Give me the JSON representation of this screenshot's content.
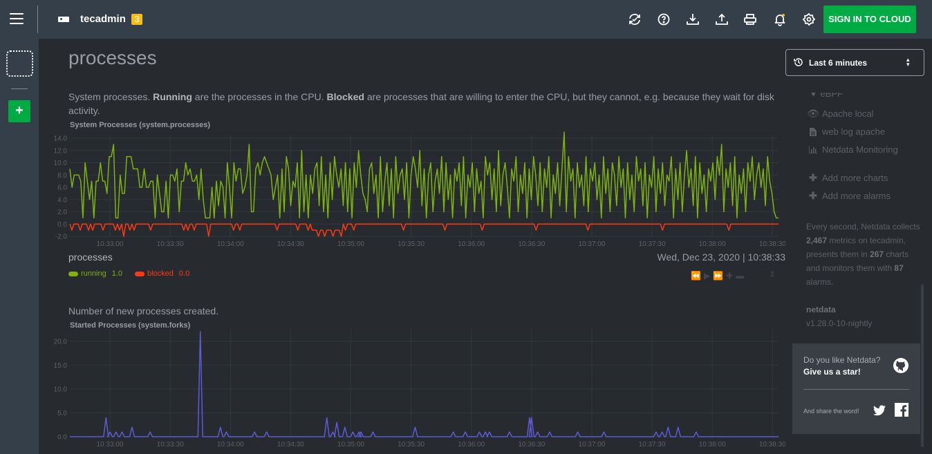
{
  "header": {
    "menu_icon": "hamburger-menu-icon",
    "host_icon": "server-icon",
    "hostname": "tecadmin",
    "alarm_badge": "3",
    "icons": [
      "sync-icon",
      "help-icon",
      "download-icon",
      "upload-icon",
      "print-icon",
      "bell-icon",
      "gear-icon"
    ],
    "signin_label": "SIGN IN TO CLOUD",
    "accent": "#00ab44",
    "badge_color": "#f7be17"
  },
  "leftbar": {
    "add_label": "+"
  },
  "section": {
    "title": "processes",
    "description_parts": [
      "System processes. ",
      "Running",
      " are the processes in the CPU. ",
      "Blocked",
      " are processes that are willing to enter the CPU, but they cannot, e.g. because they wait for disk activity."
    ],
    "forks_description": "Number of new processes created."
  },
  "legend": {
    "name": "processes",
    "datetime": "Wed, Dec 23, 2020 | 10:38:33",
    "items": [
      {
        "label": "running",
        "value": "1.0",
        "color": "#7eb30f"
      },
      {
        "label": "blocked",
        "value": "0.0",
        "color": "#fe3912"
      }
    ]
  },
  "timepicker": {
    "label": "Last 6 minutes"
  },
  "rightnav": {
    "items": [
      {
        "label": "Apache local",
        "icon": "eye-icon"
      },
      {
        "label": "web log apache",
        "icon": "file-icon"
      },
      {
        "label": "Netdata Monitoring",
        "icon": "bar-chart-icon"
      },
      {
        "label": "Add more charts",
        "icon": "plus-icon"
      },
      {
        "label": "Add more alarms",
        "icon": "plus-icon"
      }
    ],
    "stats": {
      "prefix": "Every second, Netdata collects ",
      "metrics": "2,467",
      "mid1": " metrics on tecadmin, presents them in ",
      "charts": "267",
      "mid2": " charts and monitors them with ",
      "alarms": "87",
      "suffix": " alarms."
    },
    "product": "netdata",
    "version": "v1.28.0-10-nightly",
    "star_question": "Do you like Netdata?",
    "star_cta": "Give us a star!",
    "share_text": "And share the word!"
  },
  "chart_data": [
    {
      "type": "line",
      "title": "System Processes (system.processes)",
      "ylim": [
        -2,
        14
      ],
      "yticks": [
        "14.0",
        "12.0",
        "10.0",
        "8.0",
        "6.0",
        "4.0",
        "2.0",
        "0.0",
        "-2.0"
      ],
      "ytick_values": [
        14,
        12,
        10,
        8,
        6,
        4,
        2,
        0,
        -2
      ],
      "xticks": [
        "10:33:00",
        "10:33:30",
        "10:34:00",
        "10:34:30",
        "10:35:00",
        "10:35:30",
        "10:36:00",
        "10:36:30",
        "10:37:00",
        "10:37:30",
        "10:38:00",
        "10:38:30"
      ],
      "x_range_seconds": [
        -20,
        333
      ],
      "grid": true,
      "series": [
        {
          "name": "running",
          "color": "#7eb30f",
          "values": [
            9,
            6,
            8,
            8,
            8,
            7,
            1,
            10,
            7,
            4,
            7,
            1,
            7,
            7,
            10,
            7,
            7,
            5,
            11,
            11,
            13,
            1,
            1,
            8,
            5,
            5,
            11,
            11,
            11,
            9,
            9,
            9,
            6,
            6,
            9,
            6,
            6,
            7,
            7,
            1,
            8,
            5,
            2,
            2,
            7,
            1,
            8,
            8,
            7,
            9,
            2,
            7,
            7,
            10,
            8,
            9,
            7,
            7,
            8,
            4,
            9,
            4,
            1,
            1,
            1,
            6,
            1,
            7,
            3,
            7,
            6,
            1,
            10,
            6,
            1,
            10,
            7,
            9,
            9,
            5,
            6,
            8,
            13,
            2,
            2,
            9,
            10,
            8,
            10,
            11,
            10,
            9,
            8,
            4,
            6,
            8,
            1,
            9,
            2,
            11,
            9,
            3,
            7,
            6,
            10,
            1,
            12,
            2,
            8,
            1,
            8,
            5,
            9,
            10,
            3,
            11,
            2,
            8,
            1,
            10,
            4,
            11,
            8,
            6,
            9,
            3,
            10,
            2,
            9,
            1,
            10,
            6,
            12,
            8,
            5,
            4,
            2,
            9,
            10,
            5,
            8,
            1,
            11,
            2,
            7,
            10,
            3,
            9,
            1,
            11,
            5,
            8,
            9,
            4,
            10,
            1,
            8,
            11,
            9,
            6,
            12,
            3,
            9,
            1,
            8,
            10,
            2,
            7,
            9,
            5,
            11,
            2,
            10,
            4,
            8,
            1,
            9,
            7,
            10,
            3,
            11,
            1,
            8,
            6,
            10,
            2,
            9,
            5,
            7,
            1,
            11,
            8,
            10,
            4,
            9,
            2,
            12,
            3,
            8,
            10,
            6,
            1,
            9,
            7,
            11,
            2,
            8,
            5,
            10,
            1,
            9,
            4,
            11,
            8,
            3,
            10,
            2,
            9,
            6,
            11,
            1,
            8,
            5,
            10,
            3,
            9,
            15,
            2,
            11,
            7,
            9,
            1,
            10,
            6,
            8,
            3,
            11,
            2,
            9,
            7,
            10,
            4,
            8,
            1,
            11,
            5,
            9,
            2,
            10,
            8,
            3,
            11,
            6,
            9,
            1,
            10,
            4,
            8,
            2,
            11,
            7,
            9,
            3,
            10,
            1,
            8,
            6,
            11,
            2,
            9,
            5,
            10,
            3,
            8,
            7,
            11,
            1,
            9,
            4,
            10,
            2,
            8,
            12,
            6,
            9,
            3,
            11,
            1,
            10,
            5,
            8,
            2,
            9,
            7,
            10,
            4,
            11,
            8,
            13,
            2,
            9,
            6,
            10,
            3,
            11,
            1,
            8,
            5,
            9,
            2,
            10,
            7,
            11,
            4,
            8,
            10,
            6,
            9,
            3,
            11,
            7,
            5,
            2,
            1,
            1
          ]
        },
        {
          "name": "blocked",
          "color": "#fe3912",
          "values": [
            0,
            -1,
            0,
            0,
            0,
            -1,
            0,
            0,
            0,
            -1,
            0,
            -1,
            0,
            0,
            0,
            0,
            -1,
            0,
            0,
            0,
            0,
            0,
            -1,
            0,
            -1,
            0,
            -2,
            0,
            0,
            -1,
            0,
            -1,
            0,
            0,
            0,
            0,
            0,
            0,
            0,
            -1,
            0,
            0,
            0,
            0,
            0,
            0,
            0,
            0,
            0,
            0,
            0,
            0,
            0,
            0,
            0,
            -1,
            0,
            -1,
            0,
            0,
            -1,
            0,
            0,
            0,
            0,
            0,
            0,
            -2,
            0,
            0,
            0,
            0,
            0,
            0,
            0,
            0,
            0,
            0,
            0,
            -1,
            0,
            0,
            -1,
            0,
            0,
            0,
            0,
            0,
            0,
            0,
            0,
            0,
            0,
            0,
            0,
            0,
            0,
            0,
            0,
            0,
            -1,
            0,
            0,
            0,
            0,
            0,
            0,
            0,
            0,
            0,
            -1,
            0,
            0,
            0,
            0,
            -1,
            0,
            -1,
            -1,
            -1,
            -2,
            -1,
            -1,
            -2,
            -1,
            -1,
            -1,
            -2,
            -1,
            -1,
            -1,
            -2,
            0,
            -1,
            0,
            0,
            0,
            -1,
            0,
            0,
            0,
            0,
            0,
            0,
            0,
            0,
            0,
            0,
            0,
            0,
            0,
            0,
            0,
            0,
            0,
            0,
            0,
            0,
            0,
            0,
            0,
            -1,
            0,
            0,
            0,
            0,
            0,
            0,
            0,
            0,
            0,
            0,
            0,
            0,
            0,
            0,
            0,
            0,
            0,
            0,
            0,
            -1,
            0,
            0,
            0,
            0,
            0,
            0,
            0,
            0,
            0,
            0,
            0,
            0,
            0,
            0,
            0,
            0,
            0,
            -1,
            0,
            0,
            0,
            0,
            0,
            0,
            0,
            0,
            0,
            0,
            0,
            0,
            0,
            0,
            0,
            0,
            0,
            0,
            0,
            0,
            0,
            0,
            0,
            0,
            0,
            -1,
            0,
            0,
            0,
            0,
            0,
            0,
            0,
            0,
            0,
            0,
            0,
            0,
            0,
            0,
            0,
            0,
            0,
            0,
            0,
            0,
            0,
            0,
            0,
            0,
            -1,
            0,
            0,
            0,
            0,
            0,
            0,
            0,
            0,
            0,
            0,
            0,
            0,
            0,
            0,
            0,
            0,
            0,
            0,
            0,
            0,
            0,
            0,
            0,
            0,
            0,
            0,
            0,
            0,
            0,
            0,
            0,
            0,
            0,
            0,
            0,
            -1,
            0,
            0,
            0,
            0,
            0,
            0,
            0,
            0,
            0,
            0,
            0,
            0,
            0,
            0,
            0,
            0,
            0,
            0,
            0,
            0,
            0,
            0,
            0,
            0,
            0,
            0,
            0,
            0,
            0,
            0,
            0,
            -1,
            0,
            0,
            0,
            0,
            0,
            0,
            0,
            0,
            0,
            0,
            0,
            0,
            0,
            0,
            0,
            0,
            0,
            0,
            0,
            0,
            0,
            0,
            0,
            0
          ]
        }
      ]
    },
    {
      "type": "line",
      "title": "Started Processes (system.forks)",
      "ylim": [
        0,
        22
      ],
      "yticks": [
        "20.0",
        "15.0",
        "10.0",
        "5.0",
        "0.0"
      ],
      "ytick_values": [
        20,
        15,
        10,
        5,
        0
      ],
      "xticks": [
        "10:33:00",
        "10:33:30",
        "10:34:00",
        "10:34:30",
        "10:35:00",
        "10:35:30",
        "10:36:00",
        "10:36:30",
        "10:37:00",
        "10:37:30",
        "10:38:00",
        "10:38:30"
      ],
      "x_range_seconds": [
        -20,
        333
      ],
      "grid": true,
      "series": [
        {
          "name": "started",
          "color": "#5d5bd6",
          "spikes": [
            [
              -2,
              4
            ],
            [
              0,
              1
            ],
            [
              3,
              1
            ],
            [
              6,
              1
            ],
            [
              11,
              2
            ],
            [
              20,
              1
            ],
            [
              45,
              22
            ],
            [
              55,
              2
            ],
            [
              58,
              1
            ],
            [
              72,
              1
            ],
            [
              78,
              1
            ],
            [
              108,
              4
            ],
            [
              111,
              1
            ],
            [
              113,
              3
            ],
            [
              117,
              2
            ],
            [
              121,
              1
            ],
            [
              124,
              1
            ],
            [
              125,
              1
            ],
            [
              131,
              1
            ],
            [
              152,
              2
            ],
            [
              171,
              1
            ],
            [
              177,
              1
            ],
            [
              184,
              1
            ],
            [
              187,
              1
            ],
            [
              189,
              1
            ],
            [
              199,
              1
            ],
            [
              209,
              4
            ],
            [
              210,
              4
            ],
            [
              213,
              1
            ],
            [
              219,
              1
            ],
            [
              233,
              1
            ],
            [
              246,
              1
            ],
            [
              272,
              1
            ],
            [
              275,
              1
            ],
            [
              278,
              2
            ],
            [
              283,
              2
            ],
            [
              292,
              1
            ]
          ]
        }
      ]
    }
  ]
}
